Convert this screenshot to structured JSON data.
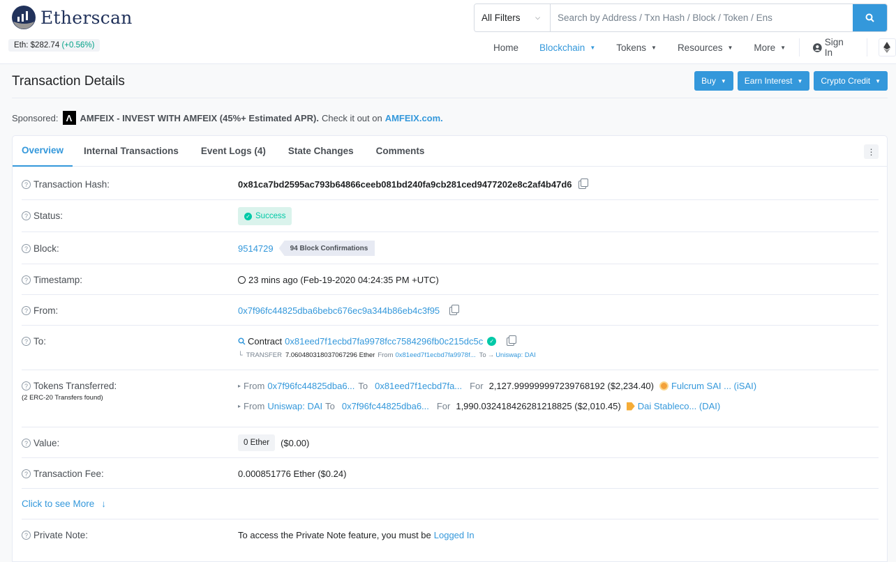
{
  "header": {
    "logo_text": "Etherscan",
    "eth_price_label": "Eth: $282.74",
    "eth_price_change": "(+0.56%)",
    "filter_label": "All Filters",
    "search_placeholder": "Search by Address / Txn Hash / Block / Token / Ens",
    "nav": [
      "Home",
      "Blockchain",
      "Tokens",
      "Resources",
      "More"
    ],
    "sign_in": "Sign In",
    "active_nav": "Blockchain"
  },
  "page": {
    "title": "Transaction Details",
    "actions": [
      "Buy",
      "Earn Interest",
      "Crypto Credit"
    ],
    "sponsored_label": "Sponsored:",
    "sponsored_text": "AMFEIX - INVEST WITH AMFEIX (45%+ Estimated APR).",
    "sponsored_tail": "Check it out on",
    "sponsored_link": "AMFEIX.com."
  },
  "tabs": [
    "Overview",
    "Internal Transactions",
    "Event Logs (4)",
    "State Changes",
    "Comments"
  ],
  "details": {
    "tx_hash_label": "Transaction Hash:",
    "tx_hash": "0x81ca7bd2595ac793b64866ceeb081bd240fa9cb281ced9477202e8c2af4b47d6",
    "status_label": "Status:",
    "status": "Success",
    "block_label": "Block:",
    "block": "9514729",
    "confirmations": "94 Block Confirmations",
    "timestamp_label": "Timestamp:",
    "timestamp": "23 mins ago (Feb-19-2020 04:24:35 PM +UTC)",
    "from_label": "From:",
    "from": "0x7f96fc44825dba6bebc676ec9a344b86eb4c3f95",
    "to_label": "To:",
    "to_prefix": "Contract",
    "to": "0x81eed7f1ecbd7fa9978fcc7584296fb0c215dc5c",
    "transfer_prefix": "TRANSFER",
    "transfer_amount": "7.060480318037067296 Ether",
    "transfer_from_label": "From",
    "transfer_from": "0x81eed7f1ecbd7fa9978f...",
    "transfer_to_label": "To",
    "transfer_to": "Uniswap: DAI",
    "tokens_label": "Tokens Transferred:",
    "tokens_sub": "(2 ERC-20 Transfers found)",
    "tokens": [
      {
        "from": "0x7f96fc44825dba6...",
        "to": "0x81eed7f1ecbd7fa...",
        "amount": "2,127.999999997239768192 ($2,234.40)",
        "token": "Fulcrum SAI ... (iSAI)",
        "color": "#f3a23a"
      },
      {
        "from": "Uniswap: DAI",
        "to": "0x7f96fc44825dba6...",
        "amount": "1,990.032418426281218825 ($2,010.45)",
        "token": "Dai Stableco... (DAI)",
        "color": "#f5ac37"
      }
    ],
    "w_from": "From",
    "w_to": "To",
    "w_for": "For",
    "value_label": "Value:",
    "value": "0 Ether",
    "value_usd": "($0.00)",
    "fee_label": "Transaction Fee:",
    "fee": "0.000851776 Ether ($0.24)",
    "see_more": "Click to see More",
    "note_label": "Private Note:",
    "note_text": "To access the Private Note feature, you must be",
    "note_link": "Logged In"
  }
}
